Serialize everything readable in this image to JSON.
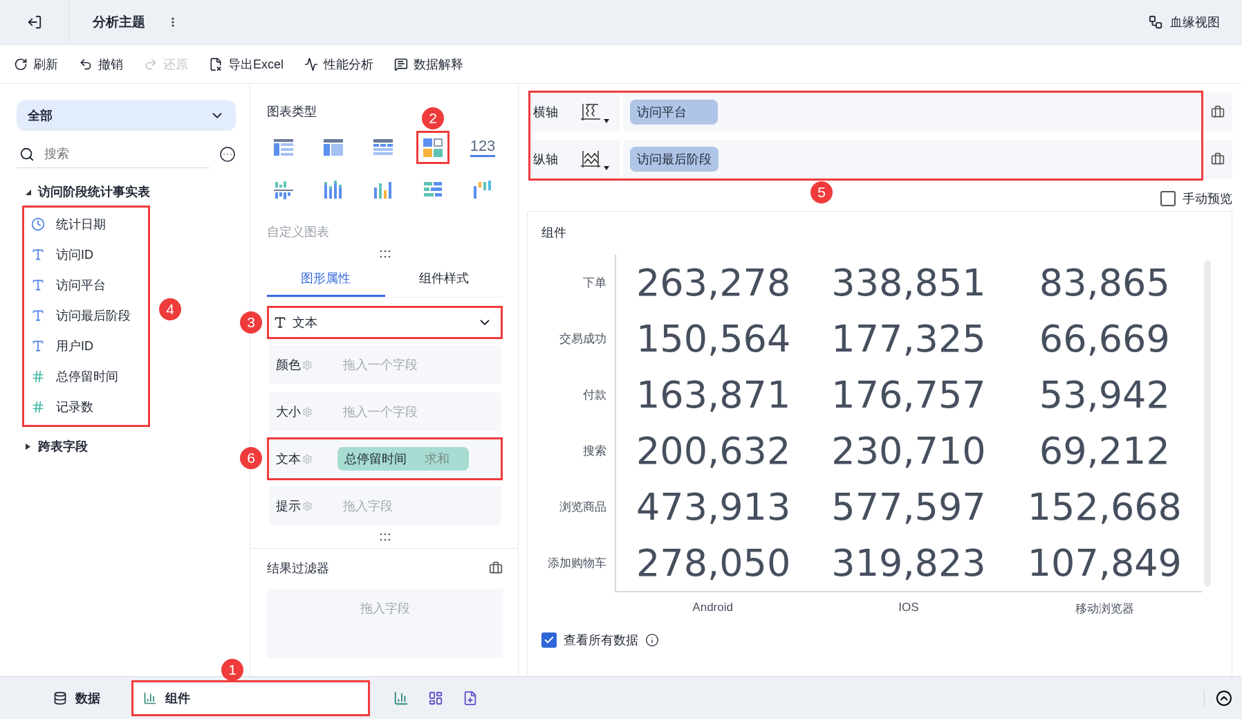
{
  "header": {
    "title": "分析主题",
    "lineage": "血缘视图"
  },
  "toolbar": [
    {
      "kind": "refresh",
      "label": "刷新",
      "disabled": false
    },
    {
      "kind": "undo",
      "label": "撤销",
      "disabled": false
    },
    {
      "kind": "redo",
      "label": "还原",
      "disabled": true
    },
    {
      "kind": "excel",
      "label": "导出Excel",
      "disabled": false
    },
    {
      "kind": "performance",
      "label": "性能分析",
      "disabled": false
    },
    {
      "kind": "explain",
      "label": "数据解释",
      "disabled": false
    }
  ],
  "data_panel": {
    "scope": "全部",
    "search_placeholder": "搜索",
    "table": {
      "name": "访问阶段统计事实表",
      "expanded": true,
      "callout": "4",
      "fields": [
        {
          "kind": "date",
          "name": "统计日期"
        },
        {
          "kind": "text",
          "name": "访问ID"
        },
        {
          "kind": "text",
          "name": "访问平台"
        },
        {
          "kind": "text",
          "name": "访问最后阶段"
        },
        {
          "kind": "text",
          "name": "用户ID"
        },
        {
          "kind": "number",
          "name": "总停留时间"
        },
        {
          "kind": "computed",
          "name": "记录数"
        }
      ]
    },
    "cross_table": {
      "name": "跨表字段",
      "expanded": false
    }
  },
  "chart_panel": {
    "title": "图表类型",
    "callout": "2",
    "chart_types": [
      {
        "kind": "table",
        "selected": false
      },
      {
        "kind": "cross",
        "selected": false
      },
      {
        "kind": "detail",
        "selected": false
      },
      {
        "kind": "blocks",
        "selected": true
      },
      {
        "kind": "kpi",
        "selected": false,
        "text": "123"
      },
      {
        "kind": "grouped",
        "selected": false
      },
      {
        "kind": "stacked",
        "selected": false
      },
      {
        "kind": "bar",
        "selected": false
      },
      {
        "kind": "hbar",
        "selected": false
      },
      {
        "kind": "waterfall",
        "selected": false
      }
    ],
    "custom": "自定义图表",
    "tabs": [
      {
        "label": "图形属性",
        "selected": true
      },
      {
        "label": "组件样式",
        "selected": false
      }
    ],
    "mark_type": {
      "label": "文本",
      "callout": "3"
    },
    "marks": [
      {
        "label": "颜色",
        "placeholder": "拖入一个字段"
      },
      {
        "label": "大小",
        "placeholder": "拖入一个字段"
      },
      {
        "label": "文本",
        "field": "总停留时间",
        "aggregation": "求和",
        "callout": "6"
      },
      {
        "label": "提示",
        "placeholder": "拖入字段"
      }
    ],
    "filter": {
      "title": "结果过滤器",
      "placeholder": "拖入字段"
    }
  },
  "axes": {
    "callout": "5",
    "rows": [
      {
        "label": "横轴",
        "kind": "x",
        "field": "访问平台"
      },
      {
        "label": "纵轴",
        "kind": "y",
        "field": "访问最后阶段"
      }
    ]
  },
  "manual_preview": {
    "label": "手动预览",
    "checked": false
  },
  "component": {
    "title": "组件",
    "columns": [
      "Android",
      "IOS",
      "移动浏览器"
    ],
    "rows": [
      {
        "label": "下单",
        "values": [
          "263,278",
          "338,851",
          "83,865"
        ]
      },
      {
        "label": "交易成功",
        "values": [
          "150,564",
          "177,325",
          "66,669"
        ]
      },
      {
        "label": "付款",
        "values": [
          "163,871",
          "176,757",
          "53,942"
        ]
      },
      {
        "label": "搜索",
        "values": [
          "200,632",
          "230,710",
          "69,212"
        ]
      },
      {
        "label": "浏览商品",
        "values": [
          "473,913",
          "577,597",
          "152,668"
        ]
      },
      {
        "label": "添加购物车",
        "values": [
          "278,050",
          "319,823",
          "107,849"
        ]
      }
    ],
    "view_all": {
      "label": "查看所有数据",
      "checked": true
    }
  },
  "bottom_tabs": [
    {
      "kind": "data",
      "label": "数据",
      "selected": false
    },
    {
      "kind": "component",
      "label": "组件",
      "selected": true,
      "callout": "1"
    }
  ],
  "bottom_actions": [
    {
      "kind": "add-chart"
    },
    {
      "kind": "add-dashboard"
    },
    {
      "kind": "add-report"
    }
  ]
}
